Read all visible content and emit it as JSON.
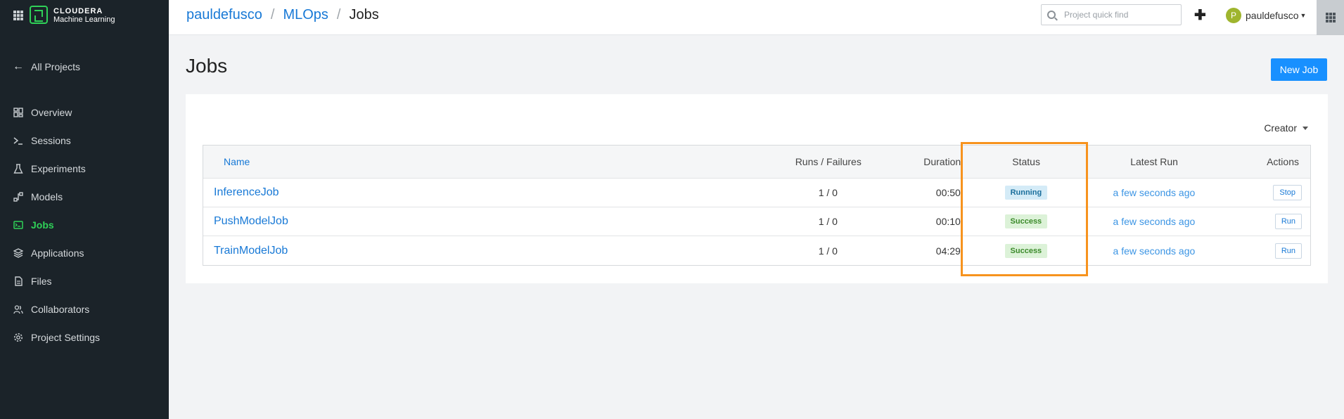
{
  "brand": {
    "name": "CLOUDERA",
    "product": "Machine Learning"
  },
  "sidebar": {
    "back_label": "All Projects",
    "items": [
      {
        "label": "Overview",
        "icon": "dashboard-icon",
        "active": false
      },
      {
        "label": "Sessions",
        "icon": "terminal-icon",
        "active": false
      },
      {
        "label": "Experiments",
        "icon": "flask-icon",
        "active": false
      },
      {
        "label": "Models",
        "icon": "models-icon",
        "active": false
      },
      {
        "label": "Jobs",
        "icon": "jobs-icon",
        "active": true
      },
      {
        "label": "Applications",
        "icon": "layers-icon",
        "active": false
      },
      {
        "label": "Files",
        "icon": "file-icon",
        "active": false
      },
      {
        "label": "Collaborators",
        "icon": "users-icon",
        "active": false
      },
      {
        "label": "Project Settings",
        "icon": "gear-icon",
        "active": false
      }
    ]
  },
  "header": {
    "breadcrumb": [
      "pauldefusco",
      "MLOps",
      "Jobs"
    ],
    "search_placeholder": "Project quick find",
    "plus_label": "✚",
    "user": {
      "initial": "P",
      "name": "pauldefusco"
    }
  },
  "main": {
    "title": "Jobs",
    "new_job_label": "New Job",
    "creator_filter": "Creator",
    "columns": [
      "Name",
      "Runs / Failures",
      "Duration",
      "Status",
      "Latest Run",
      "Actions"
    ],
    "rows": [
      {
        "name": "InferenceJob",
        "runs": "1 / 0",
        "duration": "00:50",
        "status": "Running",
        "latest": "a few seconds ago",
        "action": "Stop"
      },
      {
        "name": "PushModelJob",
        "runs": "1 / 0",
        "duration": "00:10",
        "status": "Success",
        "latest": "a few seconds ago",
        "action": "Run"
      },
      {
        "name": "TrainModelJob",
        "runs": "1 / 0",
        "duration": "04:29",
        "status": "Success",
        "latest": "a few seconds ago",
        "action": "Run"
      }
    ]
  },
  "colors": {
    "accent": "#1890ff",
    "sidebar_bg": "#1b2329",
    "active_green": "#2fd158",
    "highlight": "#f7931e"
  }
}
